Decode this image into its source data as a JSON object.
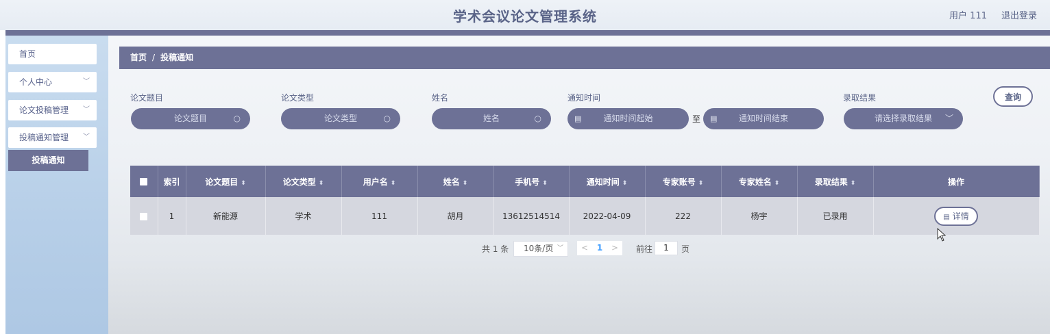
{
  "header": {
    "title": "学术会议论文管理系统",
    "user": "用户 111",
    "logout": "退出登录"
  },
  "sidebar": {
    "items": [
      {
        "label": "首页"
      },
      {
        "label": "个人中心",
        "chevron": "﹀"
      },
      {
        "label": "论文投稿管理",
        "chevron": "﹀"
      },
      {
        "label": "投稿通知管理",
        "chevron": "﹀"
      }
    ],
    "active_sub": "投稿通知"
  },
  "breadcrumb": {
    "home": "首页",
    "sep": "/",
    "current": "投稿通知"
  },
  "filters": {
    "title_label": "论文题目",
    "title_placeholder": "论文题目",
    "type_label": "论文类型",
    "type_placeholder": "论文类型",
    "name_label": "姓名",
    "name_placeholder": "姓名",
    "time_label": "通知时间",
    "time_start": "通知时间起始",
    "time_sep": "至",
    "time_end": "通知时间结束",
    "result_label": "录取结果",
    "result_placeholder": "请选择录取结果",
    "search_button": "查询"
  },
  "table": {
    "headers": [
      "索引",
      "论文题目",
      "论文类型",
      "用户名",
      "姓名",
      "手机号",
      "通知时间",
      "专家账号",
      "专家姓名",
      "录取结果",
      "操作"
    ],
    "sort_icon": "⬍",
    "rows": [
      {
        "index": "1",
        "title": "新能源",
        "type": "学术",
        "username": "111",
        "name": "胡月",
        "phone": "13612514514",
        "time": "2022-04-09",
        "expert_account": "222",
        "expert_name": "杨宇",
        "result": "已录用",
        "action": "详情"
      }
    ]
  },
  "pagination": {
    "total": "共 1 条",
    "page_size": "10条/页",
    "current_page": "1",
    "goto_prefix": "前往",
    "goto_value": "1",
    "goto_suffix": "页"
  },
  "colors": {
    "accent": "#6d7196",
    "sidebar": "#b7cfe8",
    "title": "#5a6488"
  }
}
